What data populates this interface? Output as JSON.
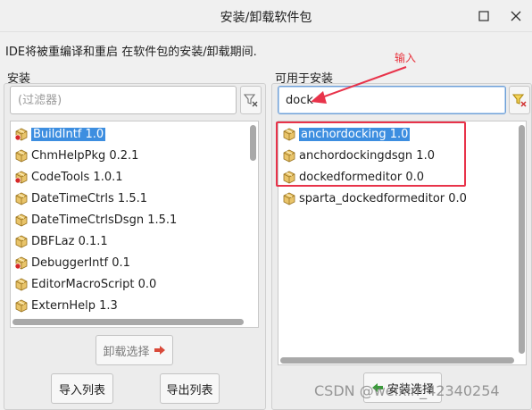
{
  "window": {
    "title": "安装/卸载软件包"
  },
  "info_text": "IDE将被重编译和重启 在软件包的安装/卸载期间.",
  "left_panel": {
    "label": "安装",
    "filter_placeholder": "(过滤器)",
    "filter_value": "",
    "items": [
      {
        "name": "BuildIntf 1.0",
        "selected": true,
        "icon": "package-dot-icon"
      },
      {
        "name": "ChmHelpPkg 0.2.1",
        "selected": false,
        "icon": "package-icon"
      },
      {
        "name": "CodeTools 1.0.1",
        "selected": false,
        "icon": "package-dot-icon"
      },
      {
        "name": "DateTimeCtrls 1.5.1",
        "selected": false,
        "icon": "package-icon"
      },
      {
        "name": "DateTimeCtrlsDsgn 1.5.1",
        "selected": false,
        "icon": "package-icon"
      },
      {
        "name": "DBFLaz 0.1.1",
        "selected": false,
        "icon": "package-icon"
      },
      {
        "name": "DebuggerIntf 0.1",
        "selected": false,
        "icon": "package-dot-icon"
      },
      {
        "name": "EditorMacroScript 0.0",
        "selected": false,
        "icon": "package-icon"
      },
      {
        "name": "ExternHelp 1.3",
        "selected": false,
        "icon": "package-icon"
      }
    ],
    "uninstall_button": "卸载选择",
    "import_button": "导入列表",
    "export_button": "导出列表"
  },
  "right_panel": {
    "label": "可用于安装",
    "filter_value": "dock",
    "items": [
      {
        "name": "anchordocking 1.0",
        "selected": true,
        "icon": "package-icon"
      },
      {
        "name": "anchordockingdsgn 1.0",
        "selected": false,
        "icon": "package-icon"
      },
      {
        "name": "dockedformeditor 0.0",
        "selected": false,
        "icon": "package-icon"
      },
      {
        "name": "sparta_dockedformeditor 0.0",
        "selected": false,
        "icon": "package-icon"
      }
    ],
    "install_button": "安装选择"
  },
  "annotation": {
    "text": "输入",
    "color": "#e8323c"
  },
  "watermark": "CSDN @weixin_42340254",
  "colors": {
    "selection": "#3d8ee0",
    "annotation_red": "#e8334a"
  }
}
